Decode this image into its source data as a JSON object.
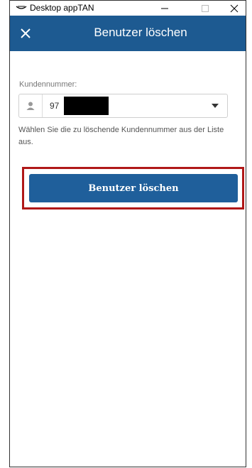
{
  "window": {
    "title": "Desktop appTAN",
    "controls": {
      "minimize_icon": "minimize-icon",
      "maximize_icon": "maximize-icon",
      "close_icon": "close-icon"
    }
  },
  "appbar": {
    "title": "Benutzer löschen",
    "close_icon": "close-x-icon",
    "background": "#1d5a91"
  },
  "form": {
    "label": "Kundennummer:",
    "selected_value": "97",
    "user_icon": "user-icon",
    "dropdown_icon": "chevron-down-icon",
    "hint": "Wählen Sie die zu löschende Kundennummer aus der Liste aus."
  },
  "actions": {
    "delete_button_label": "Benutzer löschen",
    "button_color": "#1f5f9b",
    "highlight_color": "#b01818"
  }
}
